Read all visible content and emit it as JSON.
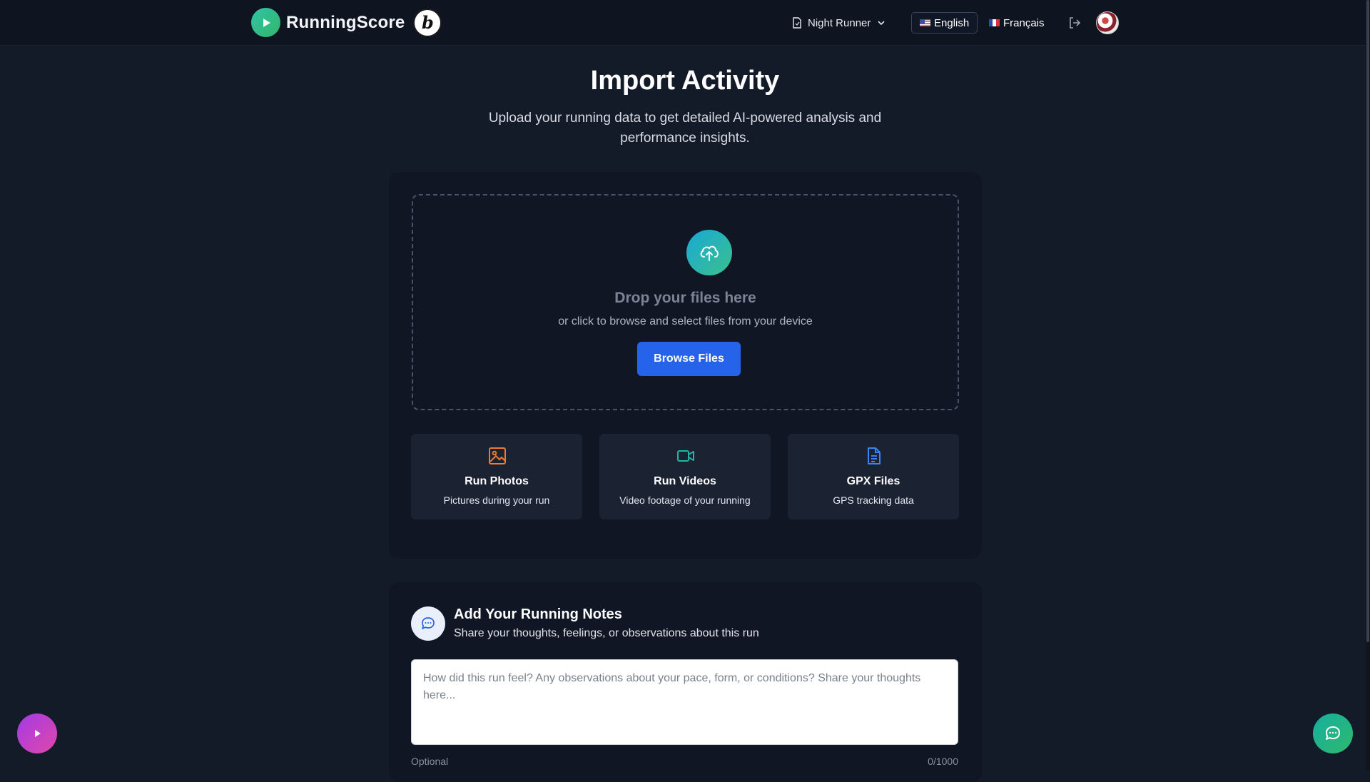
{
  "header": {
    "brand_name": "RunningScore",
    "badge_letter": "b",
    "profile_name": "Night Runner",
    "languages": [
      {
        "label": "English",
        "active": true
      },
      {
        "label": "Français",
        "active": false
      }
    ]
  },
  "main": {
    "title": "Import Activity",
    "subtitle": "Upload your running data to get detailed AI-powered analysis and performance insights."
  },
  "dropzone": {
    "title": "Drop your files here",
    "subtitle": "or click to browse and select files from your device",
    "browse_label": "Browse Files"
  },
  "file_types": [
    {
      "name": "Run Photos",
      "description": "Pictures during your run",
      "icon": "image-icon",
      "color": "#f07a2a"
    },
    {
      "name": "Run Videos",
      "description": "Video footage of your running",
      "icon": "video-icon",
      "color": "#1fb7a3"
    },
    {
      "name": "GPX Files",
      "description": "GPS tracking data",
      "icon": "document-icon",
      "color": "#3b82f6"
    }
  ],
  "notes": {
    "title": "Add Your Running Notes",
    "subtitle": "Share your thoughts, feelings, or observations about this run",
    "placeholder": "How did this run feel? Any observations about your pace, form, or conditions? Share your thoughts here...",
    "optional_label": "Optional",
    "counter": "0/1000"
  },
  "colors": {
    "background": "#141b28",
    "card": "#101624",
    "accent": "#2563eb"
  }
}
